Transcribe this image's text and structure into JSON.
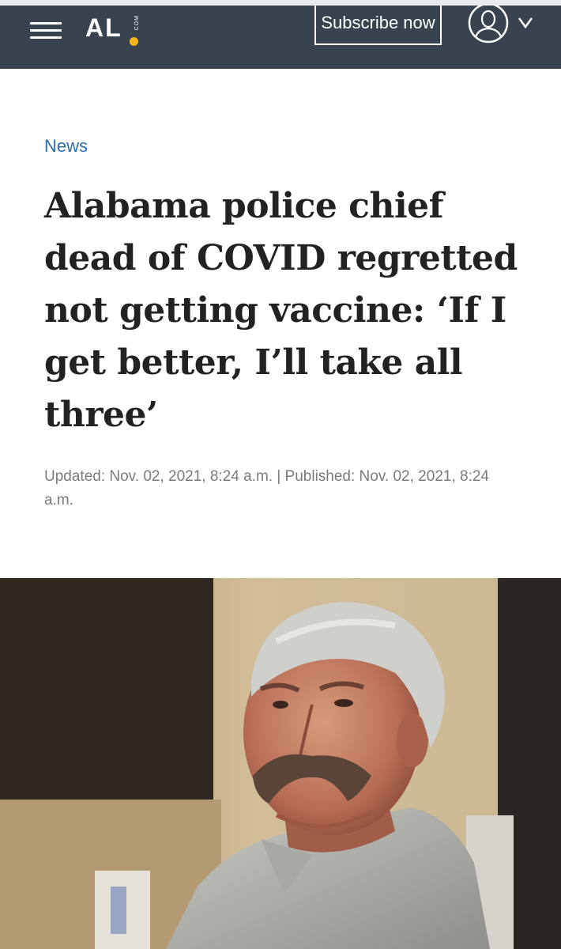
{
  "header": {
    "logo_text": "AL",
    "logo_suffix": "COM",
    "subscribe_label": "Subscribe now",
    "colors": {
      "background": "#394350",
      "logo_dot": "#f6b41f"
    }
  },
  "article": {
    "section": "News",
    "headline": "Alabama police chief dead of COVID regretted not getting vaccine: ‘If I get better, I’ll take all three’",
    "dateline": "Updated: Nov. 02, 2021, 8:24 a.m. | Published: Nov. 02, 2021, 8:24 a.m.",
    "colors": {
      "section_link": "#2b6cb0",
      "headline": "#222222",
      "dateline": "#7a7a7a"
    }
  },
  "icons": {
    "menu": "hamburger-menu-icon",
    "account": "user-account-icon",
    "dropdown": "chevron-down-icon"
  }
}
